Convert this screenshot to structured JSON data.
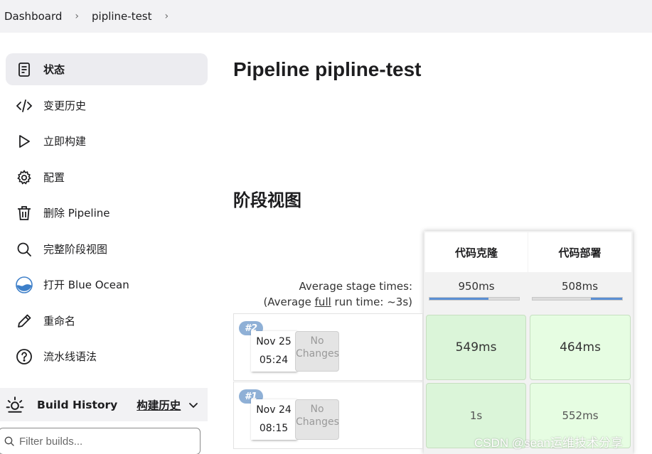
{
  "breadcrumb": {
    "items": [
      "Dashboard",
      "pipline-test"
    ],
    "sep": "›"
  },
  "sidebar": {
    "items": [
      {
        "label": "状态",
        "icon": "document-icon",
        "active": true
      },
      {
        "label": "变更历史",
        "icon": "code-icon"
      },
      {
        "label": "立即构建",
        "icon": "play-icon"
      },
      {
        "label": "配置",
        "icon": "gear-icon"
      },
      {
        "label": "删除 Pipeline",
        "icon": "trash-icon"
      },
      {
        "label": "完整阶段视图",
        "icon": "search-icon"
      },
      {
        "label": "打开 Blue Ocean",
        "icon": "blue-ocean-icon"
      },
      {
        "label": "重命名",
        "icon": "pencil-icon"
      },
      {
        "label": "流水线语法",
        "icon": "help-icon"
      }
    ],
    "build_history": {
      "label": "Build History",
      "link": "构建历史"
    },
    "filter": {
      "placeholder": "Filter builds...",
      "value": ""
    }
  },
  "main": {
    "title": "Pipeline pipline-test",
    "stage_view_title": "阶段视图",
    "stages": [
      "代码克隆",
      "代码部署"
    ],
    "avg": {
      "line1": "Average stage times:",
      "line2_prefix": "(Average ",
      "line2_link": "full",
      "line2_suffix": " run time: ~3s)",
      "times": [
        "950ms",
        "508ms"
      ],
      "progress": [
        0.66,
        0.35
      ]
    },
    "runs": [
      {
        "badge": "#2",
        "date": "Nov 25",
        "time": "05:24",
        "changes_l1": "No",
        "changes_l2": "Changes",
        "cells": [
          "549ms",
          "464ms"
        ]
      },
      {
        "badge": "#1",
        "date": "Nov 24",
        "time": "08:15",
        "changes_l1": "No",
        "changes_l2": "Changes",
        "cells": [
          "1s",
          "552ms"
        ]
      }
    ]
  },
  "watermark": "CSDN @sean运维技术分享",
  "colors": {
    "accent": "#5b8fd3",
    "success_cell": "#dbf5d9",
    "badge": "#8fb0d6"
  }
}
